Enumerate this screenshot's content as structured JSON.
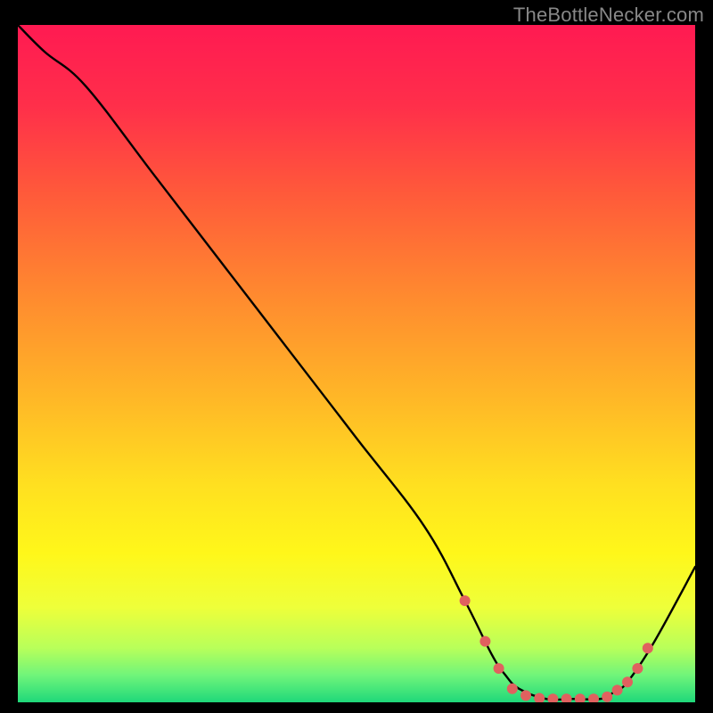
{
  "watermark": "TheBottleNecker.com",
  "gradient": {
    "stops": [
      {
        "offset": 0.0,
        "color": "#ff1a52"
      },
      {
        "offset": 0.12,
        "color": "#ff2f4a"
      },
      {
        "offset": 0.25,
        "color": "#ff5a3a"
      },
      {
        "offset": 0.4,
        "color": "#ff8a2f"
      },
      {
        "offset": 0.55,
        "color": "#ffb727"
      },
      {
        "offset": 0.68,
        "color": "#ffe020"
      },
      {
        "offset": 0.78,
        "color": "#fff71a"
      },
      {
        "offset": 0.86,
        "color": "#eeff3a"
      },
      {
        "offset": 0.92,
        "color": "#b8ff5a"
      },
      {
        "offset": 0.96,
        "color": "#70f57a"
      },
      {
        "offset": 1.0,
        "color": "#1fd87a"
      }
    ]
  },
  "marker_color": "#e0615f",
  "chart_data": {
    "type": "line",
    "title": "",
    "xlabel": "",
    "ylabel": "",
    "xlim": [
      0,
      100
    ],
    "ylim": [
      0,
      100
    ],
    "series": [
      {
        "name": "curve",
        "x": [
          0,
          4,
          10,
          20,
          30,
          40,
          50,
          60,
          66,
          70,
          72,
          74,
          78,
          82,
          86,
          88,
          90,
          94,
          100
        ],
        "y": [
          100,
          96,
          91,
          78,
          65,
          52,
          39,
          26,
          15,
          7,
          4,
          2,
          0.5,
          0.5,
          0.5,
          1.5,
          3,
          9,
          20
        ]
      }
    ],
    "markers": {
      "name": "points",
      "x": [
        66,
        69,
        71,
        73,
        75,
        77,
        79,
        81,
        83,
        85,
        87,
        88.5,
        90,
        91.5,
        93
      ],
      "y": [
        15,
        9,
        5,
        2,
        1,
        0.6,
        0.5,
        0.5,
        0.5,
        0.5,
        0.8,
        1.8,
        3,
        5,
        8
      ]
    }
  }
}
